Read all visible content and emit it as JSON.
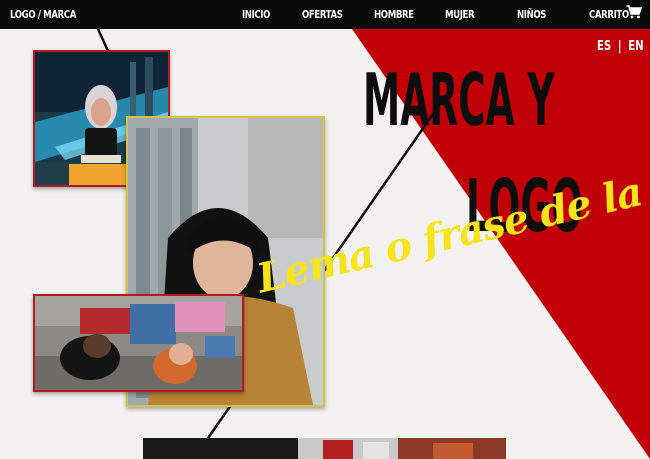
{
  "nav": {
    "logo": "LOGO / MARCA",
    "items": [
      "INICIO",
      "OFERTAS",
      "HOMBRE",
      "MUJER",
      "NIÑOS"
    ],
    "cart": "CARRITO"
  },
  "lang": {
    "es": "ES",
    "sep": "|",
    "en": "EN"
  },
  "hero": {
    "title_line1": "MARCA Y",
    "title_line2": "LOGO",
    "slogan": "Lema o frase de la marca"
  },
  "colors": {
    "nav_bg": "#0b0b0b",
    "accent_red": "#c10007",
    "slogan_yellow": "#f7e31a",
    "page_bg": "#f3f2f0"
  }
}
